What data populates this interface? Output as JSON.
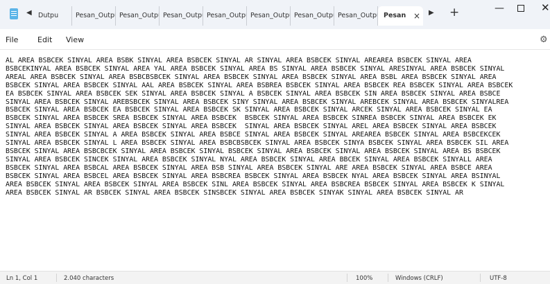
{
  "titlebar": {
    "scroll_left": "◀",
    "scroll_right": "▶",
    "new_tab": "+",
    "tabs": [
      {
        "label": "Dutpu"
      },
      {
        "label": "Pesan_Outpu"
      },
      {
        "label": "Pesan_Outpu"
      },
      {
        "label": "Pesan_Outpu"
      },
      {
        "label": "Pesan_Outpu"
      },
      {
        "label": "Pesan_Outpu"
      },
      {
        "label": "Pesan_Outpu"
      },
      {
        "label": "Pesan_Outpu"
      },
      {
        "label": "Pesan",
        "active": true
      }
    ],
    "close_tab": "×",
    "minimize": "—",
    "close_window": "✕"
  },
  "menu": {
    "file": "File",
    "edit": "Edit",
    "view": "View",
    "settings_icon": "⚙"
  },
  "editor": {
    "text": "AL AREA BSBCEK SINYAL AREA BSBK SINYAL AREA BSBCEK SINYAL AR SINYAL AREA BSBCEK SINYAL AREAREA BSBCEK SINYAL AREA\nBSBCEKINYAL AREA BSBCEK SINYAL AREA YAL AREA BSBCEK SINYAL AREA BS SINYAL AREA BSBCEK SINYAL ARESINYAL AREA BSBCEK SINYAL\nAREAL AREA BSBCEK SINYAL AREA BSBCBSBCEK SINYAL AREA BSBCEK SINYAL AREA BSBCEK SINYAL AREA BSBL AREA BSBCEK SINYAL AREA\nBSBCEK SINYAL AREA BSBCEK SINYAL AAL AREA BSBCEK SINYAL AREA BSBREA BSBCEK SINYAL AREA BSBCEK REA BSBCEK SINYAL AREA BSBCEK\nEA BSBCEK SINYAL AREA BSBCEK SEK SINYAL AREA BSBCEK SINYAL A BSBCEK SINYAL AREA BSBCEK SIN AREA BSBCEK SINYAL AREA BSBCE\nSINYAL AREA BSBCEK SINYAL AREBSBCEK SINYAL AREA BSBCEK SINY SINYAL AREA BSBCEK SINYAL AREBCEK SINYAL AREA BSBCEK SINYALREA\nBSBCEK SINYAL AREA BSBCEK EA BSBCEK SINYAL AREA BSBCEK SK SINYAL AREA BSBCEK SINYAL ARCEK SINYAL AREA BSBCEK SINYAL EA\nBSBCEK SINYAL AREA BSBCEK SREA BSBCEK SINYAL AREA BSBCEK  BSBCEK SINYAL AREA BSBCEK SINREA BSBCEK SINYAL AREA BSBCEK EK\nSINYAL AREA BSBCEK SINYAL AREA BSBCEK SINYAL AREA BSBCEK  SINYAL AREA BSBCEK SINYAL AREL AREA BSBCEK SINYAL AREA BSBCEK\nSINYAL AREA BSBCEK SINYAL A AREA BSBCEK SINYAL AREA BSBCE SINYAL AREA BSBCEK SINYAL AREAREA BSBCEK SINYAL AREA BSBCEKCEK\nSINYAL AREA BSBCEK SINYAL L AREA BSBCEK SINYAL AREA BSBCBSBCEK SINYAL AREA BSBCEK SINYA BSBCEK SINYAL AREA BSBCEK SIL AREA\nBSBCEK SINYAL AREA BSBCBCEK SINYAL AREA BSBCEK SINYAL BSBCEK SINYAL AREA BSBCEK SINYAL AREA BSBCEK SINYAL AREA BS BSBCEK\nSINYAL AREA BSBCEK SINCEK SINYAL AREA BSBCEK SINYAL NYAL AREA BSBCEK SINYAL AREA BBCEK SINYAL AREA BSBCEK SINYALL AREA\nBSBCEK SINYAL AREA BSBCAL AREA BSBCEK SINYAL AREA BSB SINYAL AREA BSBCEK SINYAL ARE AREA BSBCEK SINYAL AREA BSBCE AREA\nBSBCEK SINYAL AREA BSBCEL AREA BSBCEK SINYAL AREA BSBCREA BSBCEK SINYAL AREA BSBCEK NYAL AREA BSBCEK SINYAL AREA BSINYAL\nAREA BSBCEK SINYAL AREA BSBCEK SINYAL AREA BSBCEK SINL AREA BSBCEK SINYAL AREA BSBCREA BSBCEK SINYAL AREA BSBCEK K SINYAL\nAREA BSBCEK SINYAL AR BSBCEK SINYAL AREA BSBCEK SINSBCEK SINYAL AREA BSBCEK SINYAK SINYAL AREA BSBCEK SINYAL AR"
  },
  "status": {
    "position": "Ln 1, Col 1",
    "characters": "2.040 characters",
    "zoom": "100%",
    "line_ending": "Windows (CRLF)",
    "encoding": "UTF-8"
  }
}
